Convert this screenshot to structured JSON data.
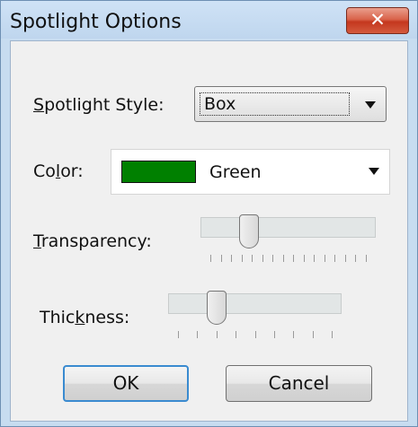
{
  "window": {
    "title": "Spotlight Options",
    "close_label": "✕"
  },
  "style": {
    "label_pre": "",
    "label_underlined": "S",
    "label_post": "potlight Style:",
    "value": "Box"
  },
  "color": {
    "label_pre": "Co",
    "label_underlined": "l",
    "label_post": "or:",
    "swatch_color": "#008000",
    "value": "Green"
  },
  "transparency": {
    "label_pre": "",
    "label_underlined": "T",
    "label_post": "ransparency:",
    "level_fraction": 0.25,
    "tick_count": 16
  },
  "thickness": {
    "label_pre": "Thic",
    "label_underlined": "k",
    "label_post": "ness:",
    "level_fraction": 0.25,
    "tick_count": 9
  },
  "buttons": {
    "ok": "OK",
    "cancel": "Cancel"
  },
  "icons": {
    "close": "close-icon",
    "dropdown": "chevron-down-icon"
  }
}
